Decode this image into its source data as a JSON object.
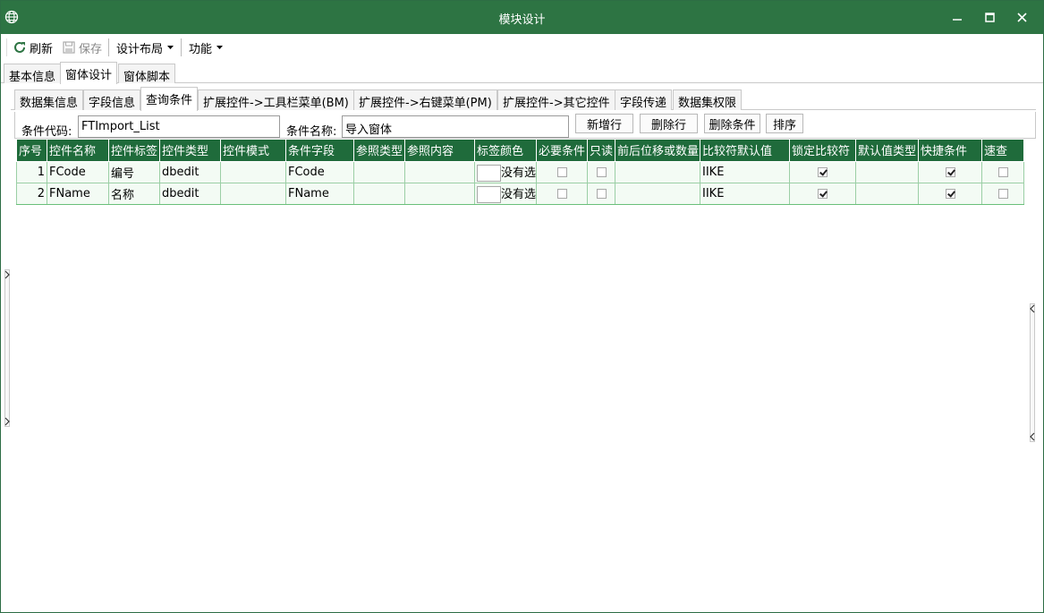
{
  "window": {
    "title": "模块设计"
  },
  "toolbar": {
    "refresh": "刷新",
    "save": "保存",
    "layout": "设计布局",
    "function": "功能"
  },
  "main_tabs": [
    {
      "label": "基本信息"
    },
    {
      "label": "窗体设计"
    },
    {
      "label": "窗体脚本"
    }
  ],
  "sub_tabs": [
    {
      "label": "数据集信息"
    },
    {
      "label": "字段信息"
    },
    {
      "label": "查询条件"
    },
    {
      "label": "扩展控件->工具栏菜单(BM)"
    },
    {
      "label": "扩展控件->右键菜单(PM)"
    },
    {
      "label": "扩展控件->其它控件"
    },
    {
      "label": "字段传递"
    },
    {
      "label": "数据集权限"
    }
  ],
  "condition": {
    "code_label": "条件代码:",
    "code_value": "FTImport_List",
    "name_label": "条件名称:",
    "name_value": "导入窗体",
    "btn_add_row": "新增行",
    "btn_delete_row": "删除行",
    "btn_delete_cond": "删除条件",
    "btn_sort": "排序"
  },
  "grid": {
    "headers": [
      "序号",
      "控件名称",
      "控件标签",
      "控件类型",
      "控件模式",
      "条件字段",
      "参照类型",
      "参照内容",
      "标签颜色",
      "必要条件",
      "只读",
      "前后位移或数量",
      "比较符默认值",
      "锁定比较符",
      "默认值类型",
      "快捷条件",
      "速查"
    ],
    "rows": [
      {
        "seq": "1",
        "name": "FCode",
        "label": "编号",
        "type": "dbedit",
        "mode": "",
        "field": "FCode",
        "ref_type": "",
        "ref_content": "",
        "color_text": "没有选",
        "required": false,
        "readonly": false,
        "offset": "",
        "compare": "IIKE",
        "lock": true,
        "default_type": "",
        "quick": true,
        "fast": false
      },
      {
        "seq": "2",
        "name": "FName",
        "label": "名称",
        "type": "dbedit",
        "mode": "",
        "field": "FName",
        "ref_type": "",
        "ref_content": "",
        "color_text": "没有选",
        "required": false,
        "readonly": false,
        "offset": "",
        "compare": "IIKE",
        "lock": true,
        "default_type": "",
        "quick": true,
        "fast": false
      }
    ]
  }
}
